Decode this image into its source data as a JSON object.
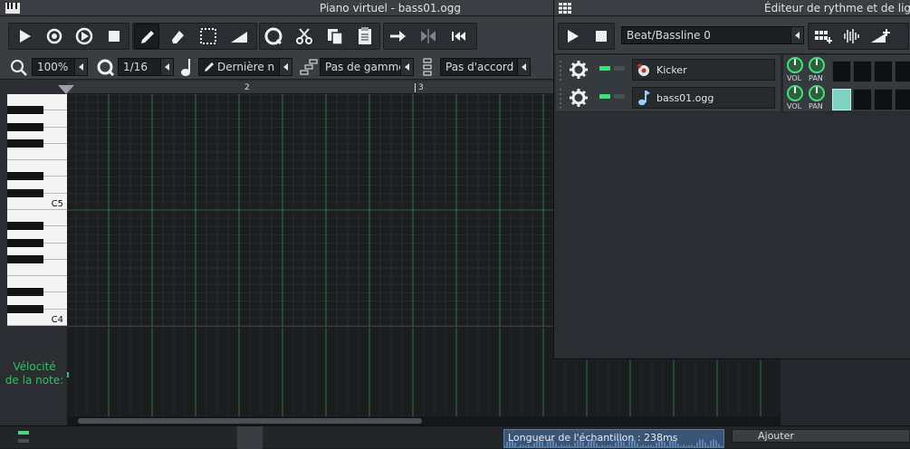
{
  "piano_roll": {
    "title": "Piano virtuel - bass01.ogg",
    "toolbar": {
      "play": "play-icon",
      "record": "record-icon",
      "record_play": "record-play-icon",
      "stop": "stop-icon",
      "draw": "pencil-icon",
      "erase": "eraser-icon",
      "select": "select-icon",
      "detune": "detune-icon",
      "quantize": "quantize-icon",
      "cut": "scissors-icon",
      "copy": "copy-icon",
      "paste": "paste-icon",
      "step_forward": "arrow-right-icon",
      "swap": "swap-icon",
      "rewind": "skip-start-icon"
    },
    "zoom": "100%",
    "quantize": "1/16",
    "note_length": "Dernière n",
    "scale": "Pas de gamme",
    "chord": "Pas d'accord",
    "timeline_marks": [
      "2",
      "3"
    ],
    "keys": [
      "C5",
      "C4"
    ],
    "velocity_label_line1": "Vélocité",
    "velocity_label_line2": "de la note:"
  },
  "beat_editor": {
    "title": "Éditeur de rythme et de ligne",
    "pattern": "Beat/Bassline 0",
    "tracks": [
      {
        "name": "Kicker",
        "vol": "VOL",
        "pan": "PAN",
        "steps_on": [
          false,
          false,
          false,
          false
        ]
      },
      {
        "name": "bass01.ogg",
        "vol": "VOL",
        "pan": "PAN",
        "steps_on": [
          true,
          false,
          false,
          false
        ]
      }
    ]
  },
  "bottom": {
    "sample_length": "Longueur de l'échantillon : 238ms",
    "add": "Ajouter"
  },
  "colors": {
    "accent_green": "#29c25f",
    "grid_line": "#2f8a4e",
    "step_on": "#7fd3c4"
  }
}
